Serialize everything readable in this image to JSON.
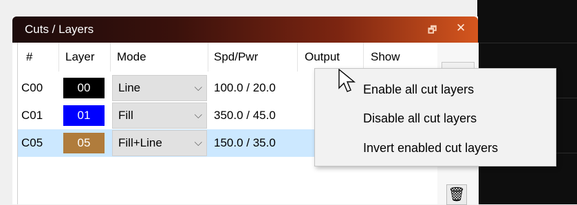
{
  "panel": {
    "title": "Cuts / Layers"
  },
  "table": {
    "headers": [
      "#",
      "Layer",
      "Mode",
      "Spd/Pwr",
      "Output",
      "Show"
    ],
    "rows": [
      {
        "id": "C00",
        "layer": "00",
        "color": "#000000",
        "mode": "Line",
        "spdpwr": "100.0 / 20.0",
        "selected": false
      },
      {
        "id": "C01",
        "layer": "01",
        "color": "#0000ff",
        "mode": "Fill",
        "spdpwr": "350.0 / 45.0",
        "selected": false
      },
      {
        "id": "C05",
        "layer": "05",
        "color": "#b07c3c",
        "mode": "Fill+Line",
        "spdpwr": "150.0 / 35.0",
        "selected": true
      }
    ]
  },
  "context_menu": {
    "items": [
      "Enable all cut layers",
      "Disable all cut layers",
      "Invert enabled cut layers"
    ]
  }
}
